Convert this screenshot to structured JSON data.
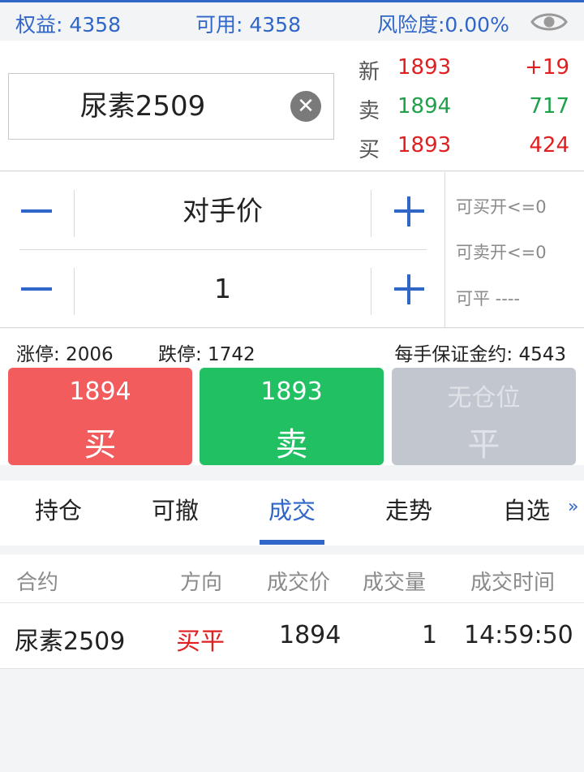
{
  "account": {
    "equity_label": "权益: 4358",
    "available_label": "可用: 4358",
    "risk_label": "风险度:0.00%",
    "eye_icon": "eye-icon"
  },
  "contract": {
    "name": "尿素2509",
    "clear_icon": "close-circle-icon",
    "clear_glyph": "✕"
  },
  "quote": {
    "last": {
      "label": "新",
      "price": "1893",
      "value": "+19"
    },
    "ask": {
      "label": "卖",
      "price": "1894",
      "value": "717"
    },
    "bid": {
      "label": "买",
      "price": "1893",
      "value": "424"
    }
  },
  "order": {
    "price_mode": "对手价",
    "quantity": "1",
    "can_buy_open": "可买开<=0",
    "can_sell_open": "可卖开<=0",
    "can_close": "可平 ----"
  },
  "limits": {
    "limit_up": "涨停: 2006",
    "limit_down": "跌停: 1742",
    "margin_per_lot": "每手保证金约: 4543"
  },
  "trade_buttons": {
    "buy": {
      "price": "1894",
      "action": "买"
    },
    "sell": {
      "price": "1893",
      "action": "卖"
    },
    "close": {
      "price": "无仓位",
      "action": "平"
    }
  },
  "tabs": {
    "items": [
      "持仓",
      "可撤",
      "成交",
      "走势",
      "自选"
    ],
    "active": "成交",
    "more_glyph": "»"
  },
  "trades_table": {
    "headers": [
      "合约",
      "方向",
      "成交价",
      "成交量",
      "成交时间"
    ],
    "rows": [
      [
        "尿素2509",
        "买平",
        "1894",
        "1",
        "14:59:50"
      ]
    ]
  },
  "colors": {
    "accent": "#2f66c7",
    "up": "#e02020",
    "down": "#1fa14a",
    "buy_button": "#f25c5c",
    "sell_button": "#21c063",
    "disabled_button": "#c2c7cf"
  }
}
